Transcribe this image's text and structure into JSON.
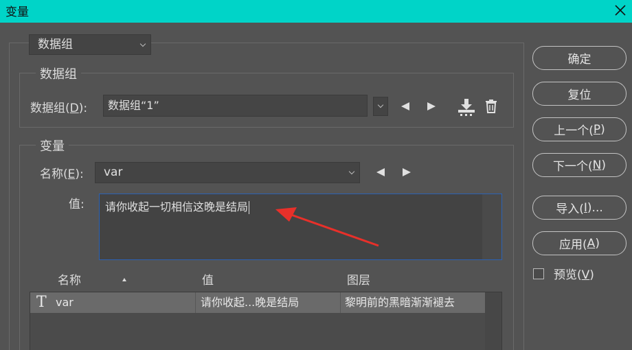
{
  "window": {
    "title": "变量"
  },
  "data_set_selector": {
    "value": "数据组"
  },
  "data_set_group": {
    "title": "数据组",
    "label_prefix": "数据组(",
    "label_key": "D",
    "label_suffix": "):",
    "value": "数据组“1”"
  },
  "variable_group": {
    "title": "变量",
    "name_label_prefix": "名称(",
    "name_label_key": "E",
    "name_label_suffix": "):",
    "name_value": "var",
    "value_label": "值:",
    "value_text": "请你收起一切相信这晚是结局"
  },
  "table": {
    "headers": [
      "名称",
      "值",
      "图层"
    ],
    "rows": [
      {
        "name": "var",
        "value": "请你收起...晚是结局",
        "layer": "黎明前的黑暗渐渐褪去"
      }
    ]
  },
  "buttons": {
    "ok": "确定",
    "reset": "复位",
    "prev_prefix": "上一个(",
    "prev_key": "P",
    "prev_suffix": ")",
    "next_prefix": "下一个(",
    "next_key": "N",
    "next_suffix": ")",
    "import_prefix": "导入(",
    "import_key": "I",
    "import_suffix": ")...",
    "apply_prefix": "应用(",
    "apply_key": "A",
    "apply_suffix": ")"
  },
  "preview": {
    "prefix": "预览(",
    "key": "V",
    "suffix": ")",
    "checked": false
  },
  "colors": {
    "titlebar": "#00d4c8",
    "background": "#535353",
    "focus_border": "#2b62b5",
    "annotation_arrow": "#e8302a"
  },
  "icons": [
    "close-icon",
    "chevron-down-icon",
    "arrow-left-icon",
    "arrow-right-icon",
    "import-data-icon",
    "trash-icon",
    "text-layer-icon",
    "sort-ascending-icon"
  ]
}
